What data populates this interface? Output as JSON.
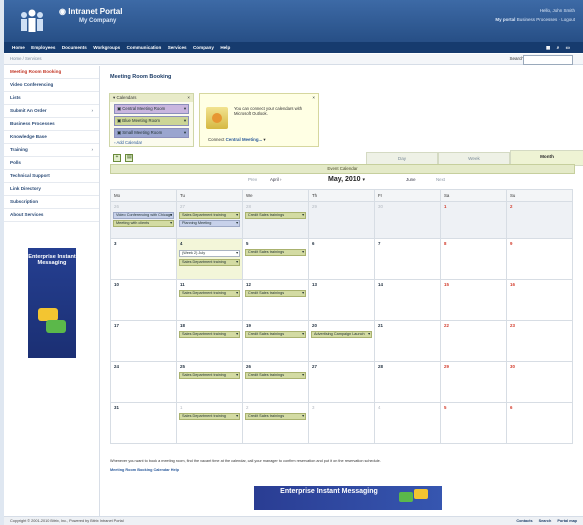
{
  "header": {
    "title": "Intranet Portal",
    "subtitle": "My Company",
    "welcome": "Hello, John Smith",
    "links": [
      "My portal",
      "Business Processes",
      "Logout"
    ]
  },
  "nav": {
    "items": [
      "Home",
      "Employees",
      "Documents",
      "Workgroups",
      "Communication",
      "Services",
      "Company",
      "Help"
    ],
    "icons": [
      "grid-icon",
      "search-icon",
      "window-icon"
    ]
  },
  "breadcrumb": "Home / Services",
  "search": {
    "label": "Search:",
    "placeholder": ""
  },
  "sidebar": {
    "items": [
      {
        "label": "Meeting Room Booking",
        "active": true,
        "arrow": ""
      },
      {
        "label": "Video Conferencing",
        "active": false,
        "arrow": ""
      },
      {
        "label": "Lists",
        "active": false,
        "arrow": ""
      },
      {
        "label": "Submit An Order",
        "active": false,
        "arrow": "›"
      },
      {
        "label": "Business Processes",
        "active": false,
        "arrow": ""
      },
      {
        "label": "Knowledge Base",
        "active": false,
        "arrow": ""
      },
      {
        "label": "Training",
        "active": false,
        "arrow": "›"
      },
      {
        "label": "Polls",
        "active": false,
        "arrow": ""
      },
      {
        "label": "Technical Support",
        "active": false,
        "arrow": ""
      },
      {
        "label": "Link Directory",
        "active": false,
        "arrow": ""
      },
      {
        "label": "Subscription",
        "active": false,
        "arrow": ""
      },
      {
        "label": "About Services",
        "active": false,
        "arrow": ""
      }
    ],
    "ad_text": "Enterprise Instant Messaging"
  },
  "main": {
    "title": "Meeting Room Booking",
    "calendars": {
      "header": "Calendars",
      "close": "×",
      "items": [
        {
          "label": "Central Meeting Room",
          "color": "#c9b6df"
        },
        {
          "label": "Blue Meeting Room",
          "color": "#ccd596"
        },
        {
          "label": "Small Meeting Room",
          "color": "#9aa5cf"
        }
      ],
      "add": "Add Calendar"
    },
    "outlook": {
      "close": "×",
      "text": "You can connect your calendars with Microsoft Outlook.",
      "link_prefix": "Connect",
      "link": "Central Meeting..."
    },
    "view_tabs": [
      {
        "label": "Day",
        "active": false
      },
      {
        "label": "Week",
        "active": false
      },
      {
        "label": "Month",
        "active": true
      }
    ],
    "event_calendar_label": "Event Calendar",
    "month_nav": {
      "prev_small": "Prev",
      "prev_month": "April",
      "title": "May, 2010",
      "next_month": "June",
      "next_small": "Next"
    },
    "weekdays": [
      "Mo",
      "Tu",
      "We",
      "Th",
      "Fr",
      "Sa",
      "Su"
    ],
    "weeks": [
      [
        {
          "day": "26",
          "kind": "other",
          "events": [
            {
              "text": "Video Conferencing with Chicago",
              "style": "b"
            },
            {
              "text": "Meeting with clients",
              "style": "g"
            }
          ]
        },
        {
          "day": "27",
          "kind": "other",
          "events": [
            {
              "text": "Sales Department training",
              "style": "g"
            },
            {
              "text": "Planning Meeting",
              "style": "b"
            }
          ]
        },
        {
          "day": "28",
          "kind": "other",
          "events": [
            {
              "text": "Credit Sales trainings",
              "style": "g"
            }
          ]
        },
        {
          "day": "29",
          "kind": "other",
          "events": []
        },
        {
          "day": "30",
          "kind": "other",
          "events": []
        },
        {
          "day": "1",
          "kind": "weekend",
          "events": []
        },
        {
          "day": "2",
          "kind": "weekend",
          "events": []
        }
      ],
      [
        {
          "day": "3",
          "kind": "normal",
          "events": []
        },
        {
          "day": "4",
          "kind": "today",
          "events": [
            {
              "text": "Sales Department training",
              "style": "g"
            }
          ],
          "select": "(Week 2) July"
        },
        {
          "day": "5",
          "kind": "normal",
          "events": [
            {
              "text": "Credit Sales trainings",
              "style": "g"
            }
          ]
        },
        {
          "day": "6",
          "kind": "normal",
          "events": []
        },
        {
          "day": "7",
          "kind": "normal",
          "events": []
        },
        {
          "day": "8",
          "kind": "weekend",
          "events": []
        },
        {
          "day": "9",
          "kind": "weekend",
          "events": []
        }
      ],
      [
        {
          "day": "10",
          "kind": "normal",
          "events": []
        },
        {
          "day": "11",
          "kind": "normal",
          "events": [
            {
              "text": "Sales Department training",
              "style": "g"
            }
          ]
        },
        {
          "day": "12",
          "kind": "normal",
          "events": [
            {
              "text": "Credit Sales trainings",
              "style": "g"
            }
          ]
        },
        {
          "day": "13",
          "kind": "normal",
          "events": []
        },
        {
          "day": "14",
          "kind": "normal",
          "events": []
        },
        {
          "day": "15",
          "kind": "weekend",
          "events": []
        },
        {
          "day": "16",
          "kind": "weekend",
          "events": []
        }
      ],
      [
        {
          "day": "17",
          "kind": "normal",
          "events": []
        },
        {
          "day": "18",
          "kind": "normal",
          "events": [
            {
              "text": "Sales Department training",
              "style": "g"
            }
          ]
        },
        {
          "day": "19",
          "kind": "normal",
          "events": [
            {
              "text": "Credit Sales trainings",
              "style": "g"
            }
          ]
        },
        {
          "day": "20",
          "kind": "normal",
          "events": [
            {
              "text": "Advertising Campaign Launch",
              "style": "g"
            }
          ]
        },
        {
          "day": "21",
          "kind": "normal",
          "events": []
        },
        {
          "day": "22",
          "kind": "weekend",
          "events": []
        },
        {
          "day": "23",
          "kind": "weekend",
          "events": []
        }
      ],
      [
        {
          "day": "24",
          "kind": "normal",
          "events": []
        },
        {
          "day": "25",
          "kind": "normal",
          "events": [
            {
              "text": "Sales Department training",
              "style": "g"
            }
          ]
        },
        {
          "day": "26",
          "kind": "normal",
          "events": [
            {
              "text": "Credit Sales trainings",
              "style": "g"
            }
          ]
        },
        {
          "day": "27",
          "kind": "normal",
          "events": []
        },
        {
          "day": "28",
          "kind": "normal",
          "events": []
        },
        {
          "day": "29",
          "kind": "weekend",
          "events": []
        },
        {
          "day": "30",
          "kind": "weekend",
          "events": []
        }
      ],
      [
        {
          "day": "31",
          "kind": "normal",
          "events": []
        },
        {
          "day": "1",
          "kind": "other",
          "events": [
            {
              "text": "Sales Department training",
              "style": "g"
            }
          ]
        },
        {
          "day": "2",
          "kind": "other",
          "events": [
            {
              "text": "Credit Sales trainings",
              "style": "g"
            }
          ]
        },
        {
          "day": "3",
          "kind": "other",
          "events": []
        },
        {
          "day": "4",
          "kind": "other",
          "events": []
        },
        {
          "day": "5",
          "kind": "weekend",
          "events": []
        },
        {
          "day": "6",
          "kind": "weekend",
          "events": []
        }
      ]
    ],
    "footnote": "Whenever you want to book a meeting room, find the vacant time at the calendar, call your manager to confirm reservation and put it on the reservation schedule.",
    "footnote_link": "Meeting Room Booking Calendar Help",
    "banner_text": "Enterprise Instant Messaging"
  },
  "footer": {
    "copyright": "Copyright © 2001-2010 Bitrix, Inc., Powered by Bitrix Intranet Portal",
    "links": [
      "Contacts",
      "Search",
      "Portal map"
    ]
  },
  "colors": {
    "header": "#2f5b95",
    "navbar": "#163b6e",
    "active_link": "#c43b2b",
    "weekend": "#d23a2a"
  }
}
